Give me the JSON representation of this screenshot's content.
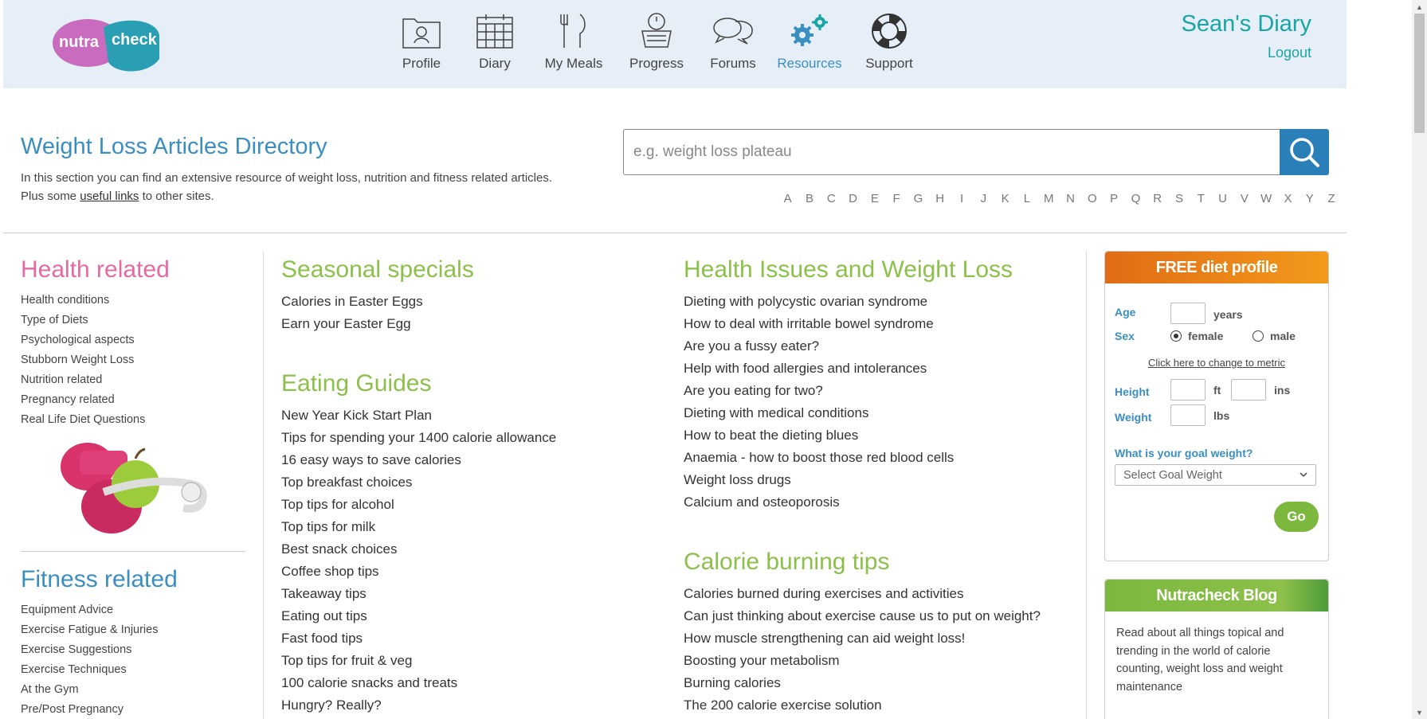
{
  "header": {
    "logo_text_left": "nutra",
    "logo_text_right": "check",
    "nav": [
      {
        "label": "Profile",
        "icon": "profile-folder-icon"
      },
      {
        "label": "Diary",
        "icon": "calendar-icon"
      },
      {
        "label": "My Meals",
        "icon": "fork-knife-icon"
      },
      {
        "label": "Progress",
        "icon": "scale-icon"
      },
      {
        "label": "Forums",
        "icon": "chat-bubbles-icon"
      },
      {
        "label": "Resources",
        "icon": "gears-icon",
        "active": true
      },
      {
        "label": "Support",
        "icon": "lifebuoy-icon"
      }
    ],
    "diary_title": "Sean's Diary",
    "logout": "Logout"
  },
  "page": {
    "title": "Weight Loss Articles Directory",
    "intro_line1": "In this section you can find an extensive resource of weight loss, nutrition and fitness related articles.",
    "intro_line2_prefix": "Plus some ",
    "intro_link": "useful links",
    "intro_line2_suffix": " to other sites.",
    "search_placeholder": "e.g. weight loss plateau",
    "alphabet": [
      "A",
      "B",
      "C",
      "D",
      "E",
      "F",
      "G",
      "H",
      "I",
      "J",
      "K",
      "L",
      "M",
      "N",
      "O",
      "P",
      "Q",
      "R",
      "S",
      "T",
      "U",
      "V",
      "W",
      "X",
      "Y",
      "Z"
    ]
  },
  "left": {
    "health_title": "Health related",
    "health_items": [
      "Health conditions",
      "Type of Diets",
      "Psychological aspects",
      "Stubborn Weight Loss",
      "Nutrition related",
      "Pregnancy related",
      "Real Life Diet Questions"
    ],
    "fitness_title": "Fitness related",
    "fitness_items": [
      "Equipment Advice",
      "Exercise Fatigue & Injuries",
      "Exercise Suggestions",
      "Exercise Techniques",
      "At the Gym",
      "Pre/Post Pregnancy"
    ]
  },
  "mid": {
    "seasonal_title": "Seasonal specials",
    "seasonal_items": [
      "Calories in Easter Eggs",
      "Earn your Easter Egg"
    ],
    "eating_title": "Eating Guides",
    "eating_items": [
      "New Year Kick Start Plan",
      "Tips for spending your 1400 calorie allowance",
      "16 easy ways to save calories",
      "Top breakfast choices",
      "Top tips for alcohol",
      "Top tips for milk",
      "Best snack choices",
      "Coffee shop tips",
      "Takeaway tips",
      "Eating out tips",
      "Fast food tips",
      "Top tips for fruit & veg",
      "100 calorie snacks and treats",
      "Hungry? Really?"
    ]
  },
  "mid2": {
    "issues_title": "Health Issues and Weight Loss",
    "issues_items": [
      "Dieting with polycystic ovarian syndrome",
      "How to deal with irritable bowel syndrome",
      "Are you a fussy eater?",
      "Help with food allergies and intolerances",
      "Are you eating for two?",
      "Dieting with medical conditions",
      "How to beat the dieting blues",
      "Anaemia - how to boost those red blood cells",
      "Weight loss drugs",
      "Calcium and osteoporosis"
    ],
    "burning_title": "Calorie burning tips",
    "burning_items": [
      "Calories burned during exercises and activities",
      "Can just thinking about exercise cause us to put on weight?",
      "How muscle strengthening can aid weight loss!",
      "Boosting your metabolism",
      "Burning calories",
      "The 200 calorie exercise solution"
    ]
  },
  "diet_profile": {
    "title": "FREE diet profile",
    "age_label": "Age",
    "age_unit": "years",
    "sex_label": "Sex",
    "female": "female",
    "male": "male",
    "selected_sex": "female",
    "metric_link": "Click here to change to metric",
    "height_label": "Height",
    "height_ft": "ft",
    "height_ins": "ins",
    "weight_label": "Weight",
    "weight_unit": "lbs",
    "goal_question": "What is your goal weight?",
    "goal_select": "Select Goal Weight",
    "go": "Go"
  },
  "blog": {
    "title": "Nutracheck Blog",
    "text": "Read about all things topical and trending in the world of calorie counting, weight loss and weight maintenance"
  },
  "colors": {
    "header_bg": "#e6eff8",
    "accent_blue": "#3b8fc0",
    "teal": "#1aa5a5",
    "pink": "#e46aa3",
    "green": "#8cc04a",
    "orange": "#f39a1a"
  }
}
